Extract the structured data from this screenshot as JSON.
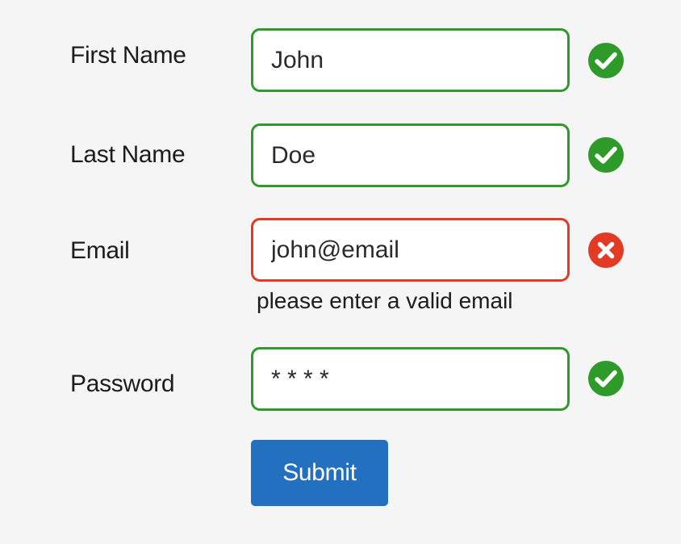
{
  "form": {
    "fields": [
      {
        "label": "First Name",
        "value": "John",
        "status": "valid",
        "status_icon": "check-circle-icon"
      },
      {
        "label": "Last Name",
        "value": "Doe",
        "status": "valid",
        "status_icon": "check-circle-icon"
      },
      {
        "label": "Email",
        "value": "john@email",
        "status": "invalid",
        "status_icon": "x-circle-icon",
        "error": "please enter a valid email"
      },
      {
        "label": "Password",
        "value": "* * * *",
        "status": "valid",
        "status_icon": "check-circle-icon"
      }
    ],
    "submit_label": "Submit"
  },
  "colors": {
    "valid": "#2e9a2a",
    "invalid": "#e23a25",
    "primary": "#236fc0",
    "background": "#f5f5f5"
  }
}
